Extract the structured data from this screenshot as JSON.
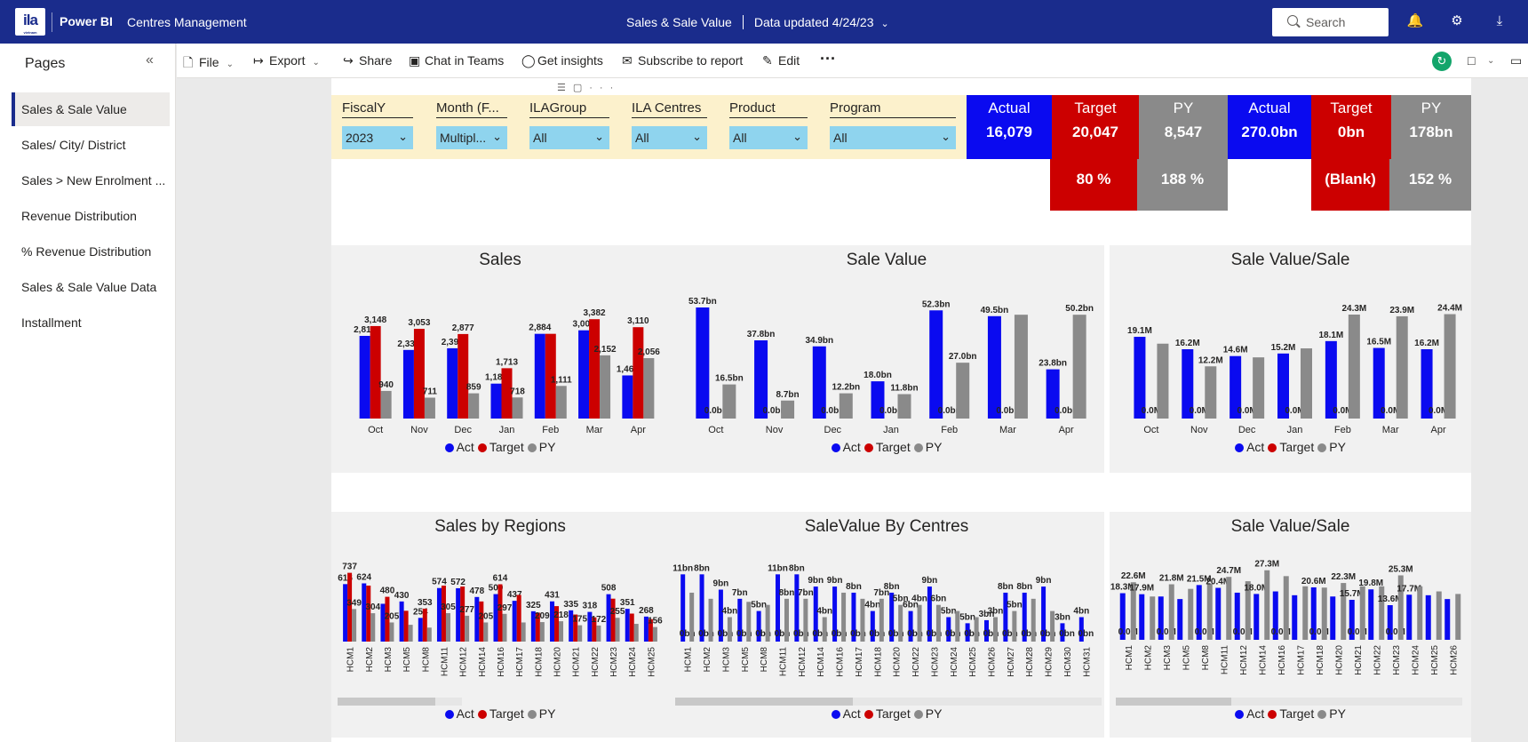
{
  "topbar": {
    "app_name": "Power BI",
    "workspace": "Centres Management",
    "report_title": "Sales & Sale Value",
    "updated": "Data updated 4/24/23",
    "search_placeholder": "Search",
    "logo_text": "ila",
    "logo_sub": "vietnam"
  },
  "pages": {
    "title": "Pages",
    "items": [
      "Sales & Sale Value",
      "Sales/ City/ District",
      "Sales > New Enrolment ...",
      "Revenue Distribution",
      "% Revenue Distribution",
      "Sales & Sale Value Data",
      "Installment"
    ],
    "active_index": 0
  },
  "actions": [
    {
      "label": "File",
      "icon": "file-icon",
      "dropdown": true
    },
    {
      "label": "Export",
      "icon": "export-icon",
      "dropdown": true
    },
    {
      "label": "Share",
      "icon": "share-icon",
      "dropdown": false
    },
    {
      "label": "Chat in Teams",
      "icon": "teams-icon",
      "dropdown": false
    },
    {
      "label": "Get insights",
      "icon": "lightbulb-icon",
      "dropdown": false
    },
    {
      "label": "Subscribe to report",
      "icon": "subscribe-icon",
      "dropdown": false
    },
    {
      "label": "Edit",
      "icon": "pencil-icon",
      "dropdown": false
    }
  ],
  "slicers": [
    {
      "label": "FiscalY",
      "value": "2023"
    },
    {
      "label": "Month (F...",
      "value": "Multipl..."
    },
    {
      "label": "ILAGroup",
      "value": "All"
    },
    {
      "label": "ILA Centres",
      "value": "All"
    },
    {
      "label": "Product",
      "value": "All"
    },
    {
      "label": "Program",
      "value": "All"
    }
  ],
  "kpis": {
    "sales": {
      "actual_label": "Actual",
      "actual": "16,079",
      "target_label": "Target",
      "target": "20,047",
      "py_label": "PY",
      "py": "8,547",
      "target_pct": "80 %",
      "py_pct": "188 %"
    },
    "value": {
      "actual_label": "Actual",
      "actual": "270.0bn",
      "target_label": "Target",
      "target": "0bn",
      "py_label": "PY",
      "py": "178bn",
      "target_pct": "(Blank)",
      "py_pct": "152 %"
    }
  },
  "colors": {
    "act": "#0a0af0",
    "target": "#cc0000",
    "py": "#8a8a8a",
    "topbar": "#1a2c8c",
    "slicer_box": "#8fd4ee",
    "slicer_band": "#fcf1cc"
  },
  "legend": {
    "act": "Act",
    "target": "Target",
    "py": "PY"
  },
  "chart_data": [
    {
      "id": "sales",
      "type": "bar",
      "title": "Sales",
      "categories": [
        "Oct",
        "Nov",
        "Dec",
        "Jan",
        "Feb",
        "Mar",
        "Apr"
      ],
      "series": [
        {
          "name": "Act",
          "values": [
            2814,
            2335,
            2393,
            1189,
            2884,
            3004,
            1468
          ],
          "labels": [
            "2,814",
            "2,335",
            "2,393",
            "1,189",
            "2,884",
            "3,004",
            "1,468"
          ]
        },
        {
          "name": "Target",
          "values": [
            3148,
            3053,
            2877,
            1713,
            2884,
            3382,
            3110
          ],
          "labels": [
            "3,148",
            "3,053",
            "2,877",
            "1,713",
            "",
            "3,382",
            "3,110"
          ]
        },
        {
          "name": "PY",
          "values": [
            940,
            711,
            859,
            718,
            1111,
            2152,
            2056
          ],
          "labels": [
            "940",
            "711",
            "859",
            "718",
            "1,111",
            "2,152",
            "2,056"
          ]
        }
      ],
      "ylim": [
        0,
        3600
      ]
    },
    {
      "id": "sale_value",
      "type": "bar",
      "title": "Sale Value",
      "categories": [
        "Oct",
        "Nov",
        "Dec",
        "Jan",
        "Feb",
        "Mar",
        "Apr"
      ],
      "series": [
        {
          "name": "Act",
          "values": [
            53.7,
            37.8,
            34.9,
            18.0,
            52.3,
            49.5,
            23.8
          ],
          "labels": [
            "53.7bn",
            "37.8bn",
            "34.9bn",
            "18.0bn",
            "52.3bn",
            "49.5bn",
            "23.8bn"
          ]
        },
        {
          "name": "Target",
          "values": [
            0,
            0,
            0,
            0,
            0,
            0,
            0
          ],
          "labels": [
            "0.0bn",
            "0.0bn",
            "0.0bn",
            "0.0bn",
            "0.0bn",
            "0.0bn",
            "0.0bn"
          ]
        },
        {
          "name": "PY",
          "values": [
            16.5,
            8.7,
            12.2,
            11.8,
            27.0,
            50.2,
            50.2
          ],
          "labels": [
            "16.5bn",
            "8.7bn",
            "12.2bn",
            "11.8bn",
            "27.0bn",
            "",
            "50.2bn"
          ]
        }
      ],
      "ylim": [
        0,
        58
      ]
    },
    {
      "id": "sale_value_per_sale",
      "type": "bar",
      "title": "Sale Value/Sale",
      "categories": [
        "Oct",
        "Nov",
        "Dec",
        "Jan",
        "Feb",
        "Mar",
        "Apr"
      ],
      "series": [
        {
          "name": "Act",
          "values": [
            19.1,
            16.2,
            14.6,
            15.2,
            18.1,
            16.5,
            16.2
          ],
          "labels": [
            "19.1M",
            "16.2M",
            "14.6M",
            "15.2M",
            "18.1M",
            "16.5M",
            "16.2M"
          ]
        },
        {
          "name": "Target",
          "values": [
            0,
            0,
            0,
            0,
            0,
            0,
            0
          ],
          "labels": [
            "0.0M",
            "0.0M",
            "0.0M",
            "0.0M",
            "0.0M",
            "0.0M",
            "0.0M"
          ]
        },
        {
          "name": "PY",
          "values": [
            17.5,
            12.2,
            14.3,
            16.4,
            24.3,
            23.9,
            24.4
          ],
          "labels": [
            "",
            "12.2M",
            "",
            "",
            "24.3M",
            "23.9M",
            "24.4M"
          ]
        }
      ],
      "ylim": [
        0,
        27
      ]
    },
    {
      "id": "sales_by_regions",
      "type": "bar",
      "title": "Sales by Regions",
      "categories": [
        "HCM1",
        "HCM2",
        "HCM3",
        "HCM5",
        "HCM8",
        "HCM11",
        "HCM12",
        "HCM14",
        "HCM16",
        "HCM17",
        "HCM18",
        "HCM20",
        "HCM21",
        "HCM22",
        "HCM23",
        "HCM24",
        "HCM25"
      ],
      "series": [
        {
          "name": "Act",
          "values": [
            616,
            624,
            405,
            430,
            254,
            574,
            572,
            478,
            509,
            437,
            325,
            431,
            335,
            318,
            508,
            351,
            268
          ],
          "labels": [
            "616",
            "624",
            "",
            "430",
            "254",
            "574",
            "572",
            "478",
            "509",
            "437",
            "325",
            "431",
            "335",
            "318",
            "508",
            "351",
            "268"
          ]
        },
        {
          "name": "Target",
          "values": [
            737,
            600,
            480,
            330,
            353,
            600,
            590,
            430,
            614,
            500,
            310,
            380,
            290,
            260,
            460,
            300,
            240
          ],
          "labels": [
            "737",
            "",
            "480",
            "",
            "353",
            "",
            "",
            "",
            "614",
            "",
            "",
            "",
            "",
            "",
            "",
            "",
            ""
          ]
        },
        {
          "name": "PY",
          "values": [
            349,
            304,
            205,
            180,
            150,
            305,
            277,
            205,
            297,
            205,
            209,
            218,
            175,
            172,
            255,
            190,
            156
          ],
          "labels": [
            "349",
            "304",
            "205",
            "",
            "",
            "305",
            "277",
            "205",
            "297",
            "",
            "209",
            "218",
            "175",
            "172",
            "255",
            "",
            "156"
          ]
        }
      ],
      "ylim": [
        0,
        800
      ]
    },
    {
      "id": "sale_value_by_centres",
      "type": "bar",
      "title": "SaleValue By Centres",
      "categories": [
        "HCM1",
        "HCM2",
        "HCM3",
        "HCM5",
        "HCM8",
        "HCM11",
        "HCM12",
        "HCM14",
        "HCM16",
        "HCM17",
        "HCM18",
        "HCM20",
        "HCM22",
        "HCM23",
        "HCM24",
        "HCM25",
        "HCM26",
        "HCM27",
        "HCM28",
        "HCM29",
        "HCM30",
        "HCM31"
      ],
      "series": [
        {
          "name": "Act",
          "values": [
            11,
            11,
            8.5,
            7,
            5,
            11,
            11,
            9,
            9,
            8,
            5,
            8,
            5,
            9,
            4,
            3,
            3.5,
            8,
            8,
            9,
            3,
            4
          ],
          "labels": [
            "11bn",
            "8bn",
            "9bn",
            "7bn",
            "5bn",
            "11bn",
            "8bn",
            "9bn",
            "9bn",
            "8bn",
            "4bn",
            "8bn",
            "6bn",
            "9bn",
            "5bn",
            "5bn",
            "3bn",
            "8bn",
            "8bn",
            "9bn",
            "3bn",
            "4bn"
          ]
        },
        {
          "name": "Target",
          "values": [
            0,
            0,
            0,
            0,
            0,
            0,
            0,
            0,
            0,
            0,
            0,
            0,
            0,
            0,
            0,
            0,
            0,
            0,
            0,
            0,
            0,
            0
          ],
          "labels": [
            "0bn",
            "0bn",
            "0bn",
            "0bn",
            "0bn",
            "0bn",
            "0bn",
            "0bn",
            "0bn",
            "0bn",
            "0bn",
            "0bn",
            "0bn",
            "0bn",
            "0bn",
            "0bn",
            "0bn",
            "0bn",
            "0bn",
            "0bn",
            "0bn",
            "0bn"
          ]
        },
        {
          "name": "PY",
          "values": [
            8,
            7,
            4,
            6.5,
            6,
            7,
            7,
            4,
            8,
            7,
            7,
            6,
            6,
            6,
            5,
            4,
            4,
            5,
            7,
            5,
            0,
            0
          ],
          "labels": [
            "",
            "",
            "4bn",
            "",
            "",
            "8bn",
            "7bn",
            "4bn",
            "",
            "",
            "7bn",
            "5bn",
            "4bn",
            "6bn",
            "",
            "",
            "3bn",
            "5bn",
            "",
            "",
            "",
            ""
          ]
        }
      ],
      "ylim": [
        0,
        12.5
      ]
    },
    {
      "id": "sale_value_per_sale_centres",
      "type": "bar",
      "title": "Sale Value/Sale",
      "categories": [
        "HCM1",
        "HCM2",
        "HCM3",
        "HCM5",
        "HCM8",
        "HCM11",
        "HCM12",
        "HCM14",
        "HCM16",
        "HCM17",
        "HCM18",
        "HCM20",
        "HCM21",
        "HCM22",
        "HCM23",
        "HCM24",
        "HCM25",
        "HCM26"
      ],
      "series": [
        {
          "name": "Act",
          "values": [
            18.3,
            17.9,
            17.0,
            16.0,
            21.5,
            20.4,
            18.5,
            18.0,
            19.0,
            17.5,
            20.6,
            17.0,
            15.7,
            19.8,
            13.6,
            17.7,
            17.5,
            16.0
          ],
          "labels": [
            "18.3M",
            "17.9M",
            "",
            "",
            "21.5M",
            "20.4M",
            "",
            "18.0M",
            "",
            "",
            "20.6M",
            "",
            "15.7M",
            "19.8M",
            "13.6M",
            "17.7M",
            "",
            ""
          ]
        },
        {
          "name": "Target",
          "values": [
            0,
            0,
            0,
            0,
            0,
            0,
            0,
            0,
            0,
            0,
            0,
            0,
            0,
            0,
            0,
            0,
            0,
            0
          ],
          "labels": [
            "0.0M",
            "",
            "0.0M",
            "",
            "0.0M",
            "",
            "0.0M",
            "",
            "0.0M",
            "",
            "0.0M",
            "",
            "0.0M",
            "",
            "0.0M",
            "",
            "",
            ""
          ]
        },
        {
          "name": "PY",
          "values": [
            22.6,
            17.0,
            21.8,
            20.0,
            22.0,
            24.7,
            23.0,
            27.3,
            25.0,
            21.0,
            20.5,
            22.3,
            21.0,
            21.0,
            25.3,
            21.0,
            19.0,
            18.0
          ],
          "labels": [
            "22.6M",
            "",
            "21.8M",
            "",
            "",
            "24.7M",
            "",
            "27.3M",
            "",
            "",
            "",
            "22.3M",
            "",
            "",
            "25.3M",
            "",
            "",
            ""
          ]
        }
      ],
      "ylim": [
        0,
        30
      ]
    }
  ]
}
